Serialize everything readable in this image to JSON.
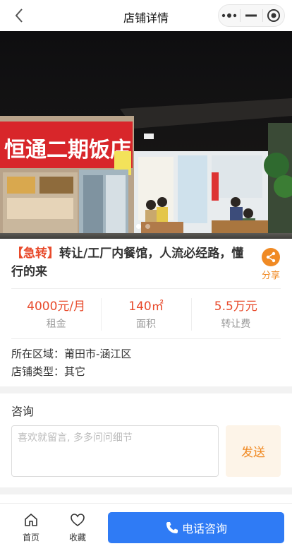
{
  "nav": {
    "title": "店铺详情"
  },
  "hero": {
    "sign_text": "恒通二期饭店",
    "slide_count": 2,
    "active_slide": 1
  },
  "listing": {
    "tag": "【急转】",
    "title": "转让/工厂内餐馆，人流必经路，懂行的来",
    "share_label": "分享"
  },
  "stats": [
    {
      "value": "4000元/月",
      "label": "租金"
    },
    {
      "value": "140㎡",
      "label": "面积"
    },
    {
      "value": "5.5万元",
      "label": "转让费"
    }
  ],
  "details": {
    "region": "所在区域：莆田市-涵江区",
    "type": "店铺类型：其它"
  },
  "consult": {
    "title": "咨询",
    "placeholder": "喜欢就留言, 多多问问细节",
    "send_label": "发送"
  },
  "bottom": {
    "home_label": "首页",
    "fav_label": "收藏",
    "call_label": "电话咨询"
  },
  "colors": {
    "accent_red": "#e84a2b",
    "accent_orange": "#f08a24",
    "primary_blue": "#2f7bf5"
  }
}
